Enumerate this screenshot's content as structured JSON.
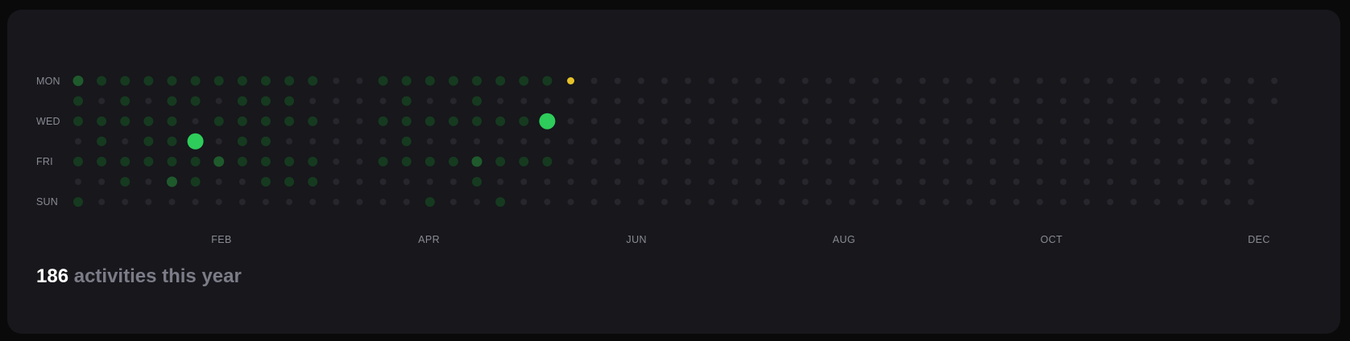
{
  "colors": {
    "empty": "#26262c",
    "level1": "#163a1f",
    "level2": "#1f5a2c",
    "level3": "#2ecc5a",
    "today": "#e6c229"
  },
  "chart_data": {
    "type": "heatmap",
    "day_labels": [
      "MON",
      "",
      "WED",
      "",
      "FRI",
      "",
      "SUN"
    ],
    "month_labels": [
      "FEB",
      "APR",
      "JUN",
      "AUG",
      "OCT",
      "DEC"
    ],
    "weeks": 52,
    "today": {
      "week": 21,
      "day": 0
    },
    "levels_note_values": "level 0=none, 1=low, 2=medium, 3=high",
    "active_weeks": [
      [
        2,
        1,
        1,
        0,
        1,
        0,
        1
      ],
      [
        1,
        0,
        1,
        1,
        1,
        0,
        0
      ],
      [
        1,
        1,
        1,
        0,
        1,
        1,
        0
      ],
      [
        1,
        0,
        1,
        1,
        1,
        0,
        0
      ],
      [
        1,
        1,
        1,
        1,
        1,
        2,
        0
      ],
      [
        1,
        1,
        0,
        3,
        1,
        1,
        0
      ],
      [
        1,
        0,
        1,
        0,
        2,
        0,
        0
      ],
      [
        1,
        1,
        1,
        1,
        1,
        0,
        0
      ],
      [
        1,
        1,
        1,
        1,
        1,
        1,
        0
      ],
      [
        1,
        1,
        1,
        0,
        1,
        1,
        0
      ],
      [
        1,
        0,
        1,
        0,
        1,
        1,
        0
      ],
      [
        0,
        0,
        0,
        0,
        0,
        0,
        0
      ],
      [
        0,
        0,
        0,
        0,
        0,
        0,
        0
      ],
      [
        1,
        0,
        1,
        0,
        1,
        0,
        0
      ],
      [
        1,
        1,
        1,
        1,
        1,
        0,
        0
      ],
      [
        1,
        0,
        1,
        0,
        1,
        0,
        1
      ],
      [
        1,
        0,
        1,
        0,
        1,
        0,
        0
      ],
      [
        1,
        1,
        1,
        0,
        2,
        1,
        0
      ],
      [
        1,
        0,
        1,
        0,
        1,
        0,
        1
      ],
      [
        1,
        0,
        1,
        0,
        1,
        0,
        0
      ],
      [
        1,
        0,
        3,
        0,
        1,
        0,
        0
      ]
    ]
  },
  "summary": {
    "count": "186",
    "text": "activities this year"
  }
}
